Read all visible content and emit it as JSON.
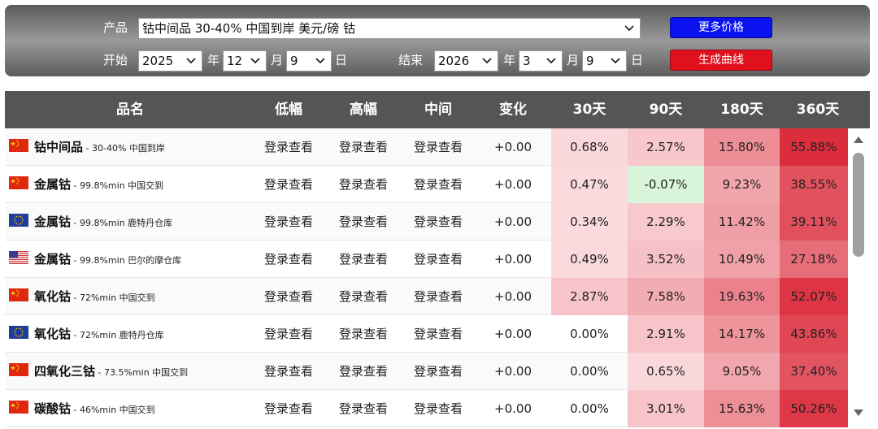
{
  "controls": {
    "product_label": "产品",
    "product_value": "钴中间品 30-40% 中国到岸 美元/磅 钴",
    "start_label": "开始",
    "end_label": "结束",
    "year_suffix": "年",
    "month_suffix": "月",
    "day_suffix": "日",
    "start_year": "2025",
    "start_month": "12",
    "start_day": "9",
    "end_year": "2026",
    "end_month": "3",
    "end_day": "9",
    "more_prices_label": "更多价格",
    "generate_curve_label": "生成曲线",
    "more_prices_color": "#0a12f0",
    "generate_curve_color": "#e0101c"
  },
  "table": {
    "headers": [
      "品名",
      "低幅",
      "高幅",
      "中间",
      "变化",
      "30天",
      "90天",
      "180天",
      "360天"
    ],
    "rows": [
      {
        "flag": "cn",
        "name": "钴中间品",
        "spec": " - 30-40% 中国到岸",
        "low": "登录查看",
        "high": "登录查看",
        "mid": "登录查看",
        "change": "+0.00",
        "d30": "0.68%",
        "d90": "2.57%",
        "d180": "15.80%",
        "d360": "55.88%"
      },
      {
        "flag": "cn",
        "name": "金属钴",
        "spec": " - 99.8%min 中国交到",
        "low": "登录查看",
        "high": "登录查看",
        "mid": "登录查看",
        "change": "+0.00",
        "d30": "0.47%",
        "d90": "-0.07%",
        "d180": "9.23%",
        "d360": "38.55%"
      },
      {
        "flag": "eu",
        "name": "金属钴",
        "spec": " - 99.8%min 鹿特丹仓库",
        "low": "登录查看",
        "high": "登录查看",
        "mid": "登录查看",
        "change": "+0.00",
        "d30": "0.34%",
        "d90": "2.29%",
        "d180": "11.42%",
        "d360": "39.11%"
      },
      {
        "flag": "us",
        "name": "金属钴",
        "spec": " - 99.8%min 巴尔的摩仓库",
        "low": "登录查看",
        "high": "登录查看",
        "mid": "登录查看",
        "change": "+0.00",
        "d30": "0.49%",
        "d90": "3.52%",
        "d180": "10.49%",
        "d360": "27.18%"
      },
      {
        "flag": "cn",
        "name": "氧化钴",
        "spec": " - 72%min 中国交到",
        "low": "登录查看",
        "high": "登录查看",
        "mid": "登录查看",
        "change": "+0.00",
        "d30": "2.87%",
        "d90": "7.58%",
        "d180": "19.63%",
        "d360": "52.07%"
      },
      {
        "flag": "eu",
        "name": "氧化钴",
        "spec": " - 72%min 鹿特丹仓库",
        "low": "登录查看",
        "high": "登录查看",
        "mid": "登录查看",
        "change": "+0.00",
        "d30": "0.00%",
        "d90": "2.91%",
        "d180": "14.17%",
        "d360": "43.86%"
      },
      {
        "flag": "cn",
        "name": "四氧化三钴",
        "spec": " - 73.5%min 中国交到",
        "low": "登录查看",
        "high": "登录查看",
        "mid": "登录查看",
        "change": "+0.00",
        "d30": "0.00%",
        "d90": "0.65%",
        "d180": "9.05%",
        "d360": "37.40%"
      },
      {
        "flag": "cn",
        "name": "碳酸钴",
        "spec": " - 46%min 中国交到",
        "low": "登录查看",
        "high": "登录查看",
        "mid": "登录查看",
        "change": "+0.00",
        "d30": "0.00%",
        "d90": "3.01%",
        "d180": "15.63%",
        "d360": "50.26%"
      }
    ]
  },
  "icons": {
    "dropdown": "chevron-down-icon",
    "scroll_up": "triangle-up-icon",
    "scroll_down": "triangle-down-icon",
    "flags": {
      "cn": "china-flag-icon",
      "eu": "eu-flag-icon",
      "us": "us-flag-icon"
    }
  },
  "colors": {
    "header_bg": "#555555",
    "negative_bg": "#d7f5d9",
    "heat_low": "#fce4e6",
    "heat_high": "#dc2d3c"
  }
}
